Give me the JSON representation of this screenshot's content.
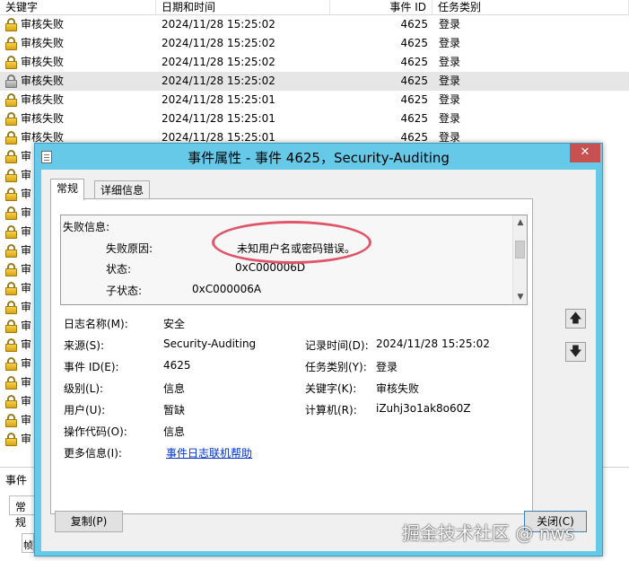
{
  "list": {
    "headers": {
      "keyword": "关键字",
      "datetime": "日期和时间",
      "event_id": "事件 ID",
      "category": "任务类别"
    },
    "rows": [
      {
        "keyword": "审核失败",
        "datetime": "2024/11/28 15:25:02",
        "event_id": "4625",
        "category": "登录"
      },
      {
        "keyword": "审核失败",
        "datetime": "2024/11/28 15:25:02",
        "event_id": "4625",
        "category": "登录"
      },
      {
        "keyword": "审核失败",
        "datetime": "2024/11/28 15:25:02",
        "event_id": "4625",
        "category": "登录"
      },
      {
        "keyword": "审核失败",
        "datetime": "2024/11/28 15:25:02",
        "event_id": "4625",
        "category": "登录",
        "selected": true
      },
      {
        "keyword": "审核失败",
        "datetime": "2024/11/28 15:25:01",
        "event_id": "4625",
        "category": "登录"
      },
      {
        "keyword": "审核失败",
        "datetime": "2024/11/28 15:25:01",
        "event_id": "4625",
        "category": "登录"
      },
      {
        "keyword": "审核失败",
        "datetime": "2024/11/28 15:25:01",
        "event_id": "4625",
        "category": "登录"
      },
      {
        "keyword": "审"
      },
      {
        "keyword": "审"
      },
      {
        "keyword": "审"
      },
      {
        "keyword": "审"
      },
      {
        "keyword": "审"
      },
      {
        "keyword": "审"
      },
      {
        "keyword": "审"
      },
      {
        "keyword": "审"
      },
      {
        "keyword": "审"
      },
      {
        "keyword": "审"
      },
      {
        "keyword": "审"
      },
      {
        "keyword": "审"
      },
      {
        "keyword": "审"
      },
      {
        "keyword": "审"
      },
      {
        "keyword": "审"
      },
      {
        "keyword": "审"
      }
    ]
  },
  "bottom_pane": {
    "label": "事件",
    "tab": "常规",
    "text": "帧"
  },
  "dialog": {
    "title": "事件属性 - 事件 4625，Security-Auditing",
    "close_glyph": "✕",
    "tabs": {
      "general": "常规",
      "details": "详细信息"
    },
    "description": {
      "heading": "失败信息:",
      "lines": [
        {
          "label": "失败原因:",
          "value": "未知用户名或密码错误。"
        },
        {
          "label": "状态:",
          "value": "0xC000006D"
        },
        {
          "label": "子状态:",
          "value": "0xC000006A"
        }
      ]
    },
    "fields": {
      "log_name_label": "日志名称(M):",
      "log_name_value": "安全",
      "source_label": "来源(S):",
      "source_value": "Security-Auditing",
      "logged_label": "记录时间(D):",
      "logged_value": "2024/11/28 15:25:02",
      "event_id_label": "事件 ID(E):",
      "event_id_value": "4625",
      "task_category_label": "任务类别(Y):",
      "task_category_value": "登录",
      "level_label": "级别(L):",
      "level_value": "信息",
      "keywords_label": "关键字(K):",
      "keywords_value": "审核失败",
      "user_label": "用户(U):",
      "user_value": "暂缺",
      "computer_label": "计算机(R):",
      "computer_value": "iZuhj3o1ak8o60Z",
      "opcode_label": "操作代码(O):",
      "opcode_value": "信息",
      "more_info_label": "更多信息(I):",
      "more_info_link": "事件日志联机帮助"
    },
    "buttons": {
      "copy": "复制(P)",
      "close": "关闭(C)",
      "up_glyph": "🡅",
      "down_glyph": "🡇"
    }
  },
  "watermark": "掘金技术社区 @ nws",
  "colors": {
    "title_bar": "#66c9e8",
    "close_button": "#c75050",
    "highlight_ellipse": "#e0556a",
    "link": "#0033cc"
  }
}
